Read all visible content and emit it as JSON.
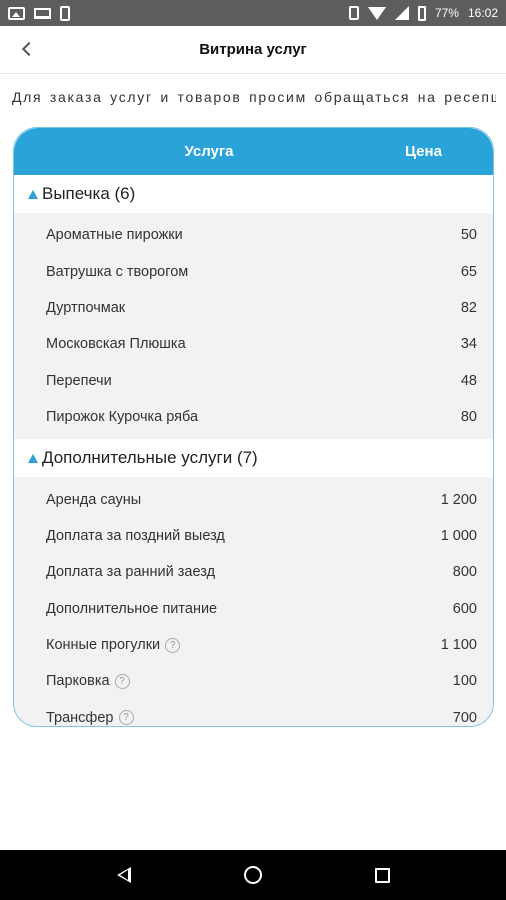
{
  "status_bar": {
    "left_icons": [
      "image-icon",
      "laptop-icon",
      "phone-icon"
    ],
    "right_icons": [
      "vibrate-icon",
      "wifi-icon",
      "signal-icon",
      "battery-icon"
    ],
    "battery": "77%",
    "time": "16:02"
  },
  "header": {
    "title": "Витрина услуг",
    "back_icon": "chevron-left-icon"
  },
  "info_text": "Для заказа услуг и товаров просим обращаться на ресепш",
  "table": {
    "col_service": "Услуга",
    "col_price": "Цена",
    "accent_color": "#2aa4d8",
    "groups": [
      {
        "title": "Выпечка (6)",
        "items": [
          {
            "name": "Ароматные пирожки",
            "price": "50"
          },
          {
            "name": "Ватрушка с творогом",
            "price": "65"
          },
          {
            "name": "Дуртпочмак",
            "price": "82"
          },
          {
            "name": "Московская Плюшка",
            "price": "34"
          },
          {
            "name": "Перепечи",
            "price": "48"
          },
          {
            "name": "Пирожок Курочка ряба",
            "price": "80"
          }
        ]
      },
      {
        "title": "Дополнительные услуги (7)",
        "items": [
          {
            "name": "Аренда сауны",
            "price": "1 200"
          },
          {
            "name": "Доплата за поздний выезд",
            "price": "1 000"
          },
          {
            "name": "Доплата за ранний заезд",
            "price": "800"
          },
          {
            "name": "Дополнительное питание",
            "price": "600"
          },
          {
            "name": "Конные прогулки",
            "price": "1 100",
            "help": "?"
          },
          {
            "name": "Парковка",
            "price": "100",
            "help": "?"
          },
          {
            "name": "Трансфер",
            "price": "700",
            "help": "?"
          }
        ]
      }
    ]
  },
  "nav_bar": {
    "icons": [
      "nav-back-icon",
      "nav-home-icon",
      "nav-recents-icon"
    ]
  }
}
